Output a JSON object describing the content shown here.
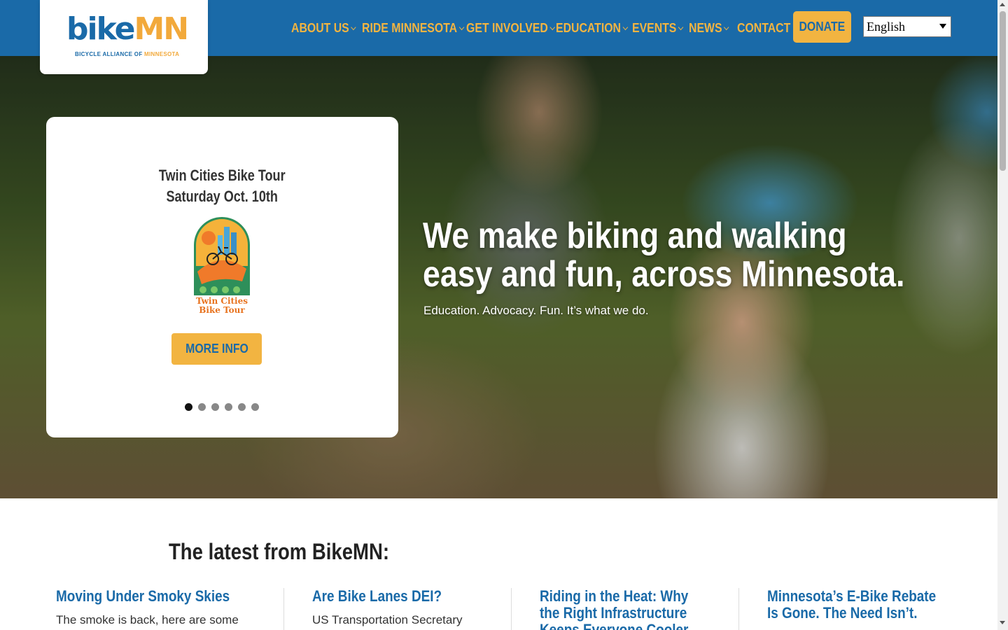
{
  "logo": {
    "word_part1": "bike",
    "word_part2": "MN",
    "tagline_part1": "BICYCLE ALLIANCE OF ",
    "tagline_part2": "MINNESOTA"
  },
  "nav": {
    "items": [
      {
        "label": "ABOUT US",
        "dropdown": true
      },
      {
        "label": "RIDE MINNESOTA",
        "dropdown": true
      },
      {
        "label": "GET INVOLVED",
        "dropdown": true
      },
      {
        "label": "EDUCATION",
        "dropdown": true
      },
      {
        "label": "EVENTS",
        "dropdown": true
      },
      {
        "label": "NEWS",
        "dropdown": true
      },
      {
        "label": "CONTACT",
        "dropdown": false
      }
    ],
    "donate_label": "DONATE",
    "language": "English"
  },
  "hero": {
    "card": {
      "title_line1": "Twin Cities Bike Tour",
      "title_line2": "Saturday Oct. 10th",
      "badge_text_line1": "Twin Cities",
      "badge_text_line2": "Bike Tour",
      "button_label": "MORE INFO",
      "slide_count": 6,
      "active_slide": 1
    },
    "headline": "We make biking and walking easy and fun, across Minnesota.",
    "subheadline": "Education. Advocacy. Fun. It’s what we do."
  },
  "latest": {
    "heading": "The latest from BikeMN:",
    "posts": [
      {
        "title": "Moving Under Smoky Skies",
        "excerpt": "The smoke is back, here are some"
      },
      {
        "title": "Are Bike Lanes DEI?",
        "excerpt": "US Transportation Secretary"
      },
      {
        "title": "Riding in the Heat: Why the Right Infrastructure Keeps Everyone Cooler",
        "excerpt": ""
      },
      {
        "title": "Minnesota’s E-Bike Rebate Is Gone. The Need Isn’t.",
        "excerpt": ""
      }
    ]
  },
  "colors": {
    "brand_blue": "#1a6aa8",
    "brand_gold": "#f2b441"
  }
}
